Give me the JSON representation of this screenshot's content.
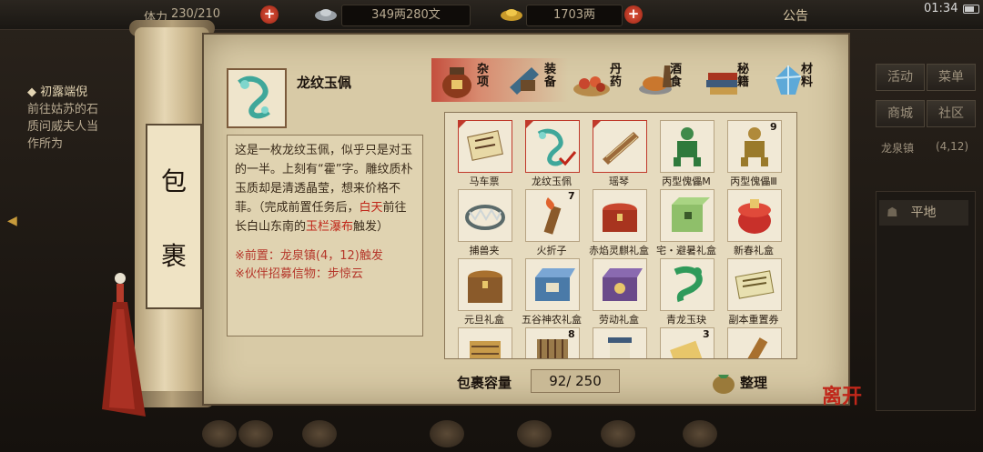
{
  "topbar": {
    "stamina_label": "体力",
    "stamina_value": "230/210",
    "silver_value": "349两280文",
    "gold_value": "1703两",
    "announce": "公告",
    "clock": "01:34"
  },
  "quest": {
    "title": "◆ 初露端倪",
    "lines": [
      "前往姑苏的石",
      "质问威夫人当",
      "作所为"
    ]
  },
  "right_panel": {
    "buttons": [
      "活动",
      "菜单",
      "商城",
      "社区"
    ],
    "location": "龙泉镇",
    "coords": "(4,12)",
    "list_item": "平地"
  },
  "scroll": {
    "title_chars": [
      "包",
      "裹"
    ]
  },
  "item": {
    "name": "龙纹玉佩",
    "icon": "jade-pendant-icon",
    "desc_a": "这是一枚龙纹玉佩，似乎只是对玉的一半。上刻有“霍”字。雕纹质朴玉质却是清透晶莹，想来价格不菲。（完成前置任务后，",
    "desc_red1": "白天",
    "desc_b": "前往长白山东南的",
    "desc_red2": "玉栏瀑布",
    "desc_c": "触发）",
    "note1": "※前置：龙泉镇(4，12)触发",
    "note2": "※伙伴招募信物：步惊云"
  },
  "tabs": [
    {
      "label": "杂项",
      "icon": "jar-icon",
      "selected": true
    },
    {
      "label": "装备",
      "icon": "equipment-icon",
      "selected": false
    },
    {
      "label": "丹药",
      "icon": "pills-icon",
      "selected": false
    },
    {
      "label": "酒食",
      "icon": "food-icon",
      "selected": false
    },
    {
      "label": "秘籍",
      "icon": "book-icon",
      "selected": false
    },
    {
      "label": "材料",
      "icon": "crystal-icon",
      "selected": false
    }
  ],
  "grid": [
    {
      "label": "马车票",
      "icon": "ticket-icon",
      "count": "",
      "marked": true
    },
    {
      "label": "龙纹玉佩",
      "icon": "jade-pendant-icon",
      "count": "",
      "marked": true,
      "selected": true
    },
    {
      "label": "瑶琴",
      "icon": "zither-icon",
      "count": "",
      "marked": true
    },
    {
      "label": "丙型傀儡M",
      "icon": "green-puppet-icon",
      "count": ""
    },
    {
      "label": "丙型傀儡Ⅲ",
      "icon": "gold-puppet-icon",
      "count": "9"
    },
    {
      "label": "捕兽夹",
      "icon": "trap-icon",
      "count": ""
    },
    {
      "label": "火折子",
      "icon": "fire-starter-icon",
      "count": "7"
    },
    {
      "label": "赤焰灵麒礼盒",
      "icon": "red-chest-icon",
      "count": ""
    },
    {
      "label": "宅・避暑礼盒",
      "icon": "jade-box-icon",
      "count": ""
    },
    {
      "label": "新春礼盒",
      "icon": "red-giftbox-icon",
      "count": ""
    },
    {
      "label": "元旦礼盒",
      "icon": "wood-chest-icon",
      "count": ""
    },
    {
      "label": "五谷神农礼盒",
      "icon": "blue-box-icon",
      "count": ""
    },
    {
      "label": "劳动礼盒",
      "icon": "purple-box-icon",
      "count": ""
    },
    {
      "label": "青龙玉玦",
      "icon": "dragon-jade-icon",
      "count": ""
    },
    {
      "label": "副本重置券",
      "icon": "voucher-icon",
      "count": ""
    },
    {
      "label": "",
      "icon": "scroll-bundle-icon",
      "count": ""
    },
    {
      "label": "",
      "icon": "cylinder-icon",
      "count": "8"
    },
    {
      "label": "",
      "icon": "blue-scroll-icon",
      "count": ""
    },
    {
      "label": "",
      "icon": "paper-scroll-icon",
      "count": "3"
    },
    {
      "label": "",
      "icon": "wood-stick-icon",
      "count": ""
    }
  ],
  "capacity": {
    "label": "包裹容量",
    "value": "92/ 250"
  },
  "sort_label": "整理",
  "leave_label": "离开",
  "colors": {
    "paper": "#d8caa6",
    "accent_red": "#c0271a",
    "frame": "#5a4a35"
  }
}
